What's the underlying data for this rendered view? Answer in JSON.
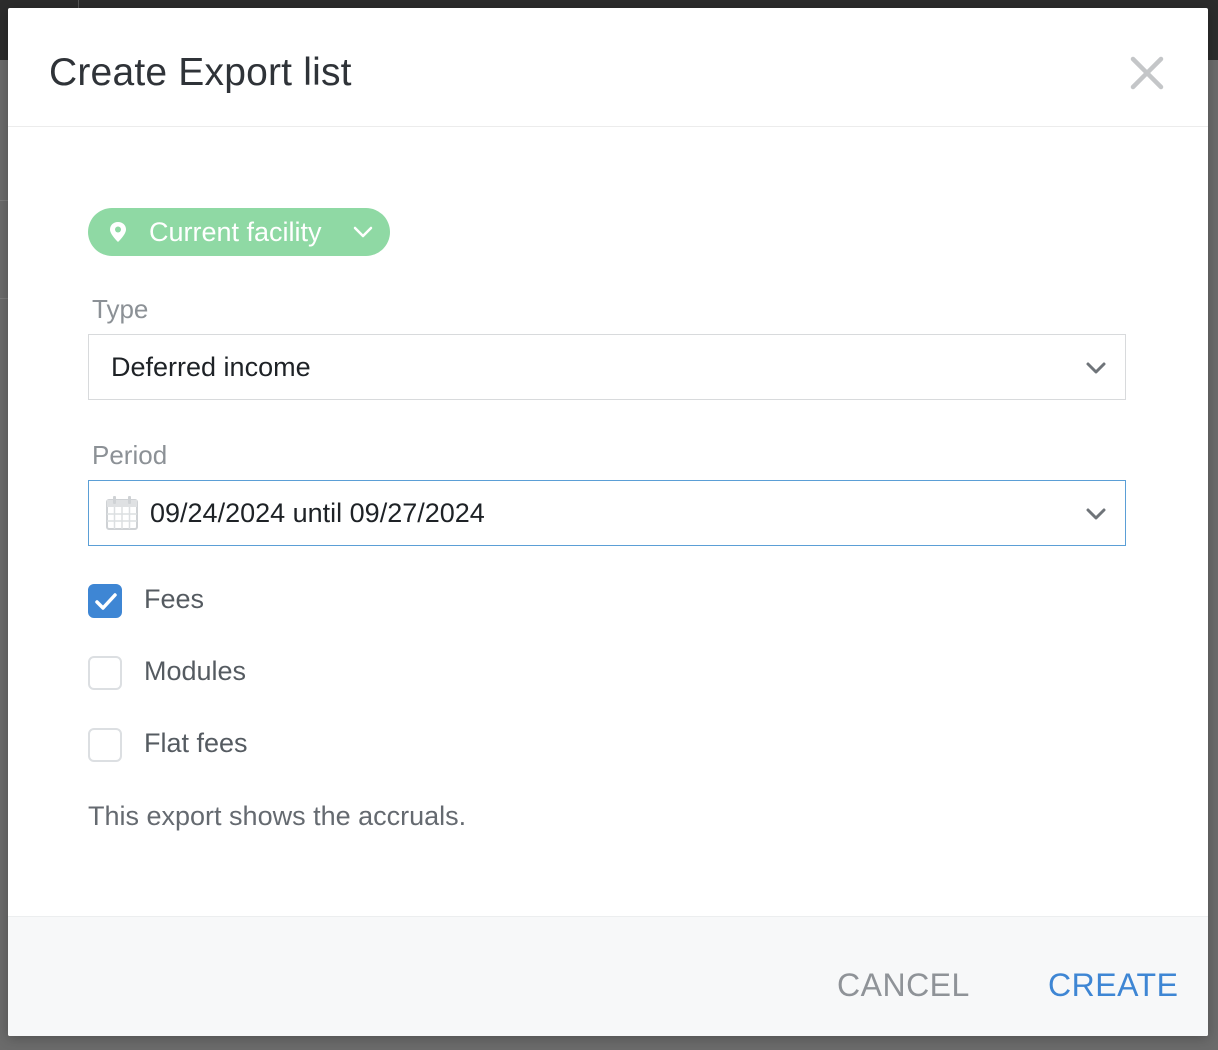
{
  "dialog": {
    "title": "Create Export list",
    "close_icon": "close-icon"
  },
  "facility": {
    "label": "Current facility",
    "icon": "location-pin-icon",
    "color": "#8fd9a4"
  },
  "type": {
    "label": "Type",
    "value": "Deferred income"
  },
  "period": {
    "label": "Period",
    "value": "09/24/2024 until 09/27/2024",
    "icon": "calendar-icon"
  },
  "options": [
    {
      "label": "Fees",
      "checked": true
    },
    {
      "label": "Modules",
      "checked": false
    },
    {
      "label": "Flat fees",
      "checked": false
    }
  ],
  "info": "This export shows the accruals.",
  "footer": {
    "cancel_label": "CANCEL",
    "create_label": "CREATE",
    "accent_color": "#3e86d4"
  }
}
